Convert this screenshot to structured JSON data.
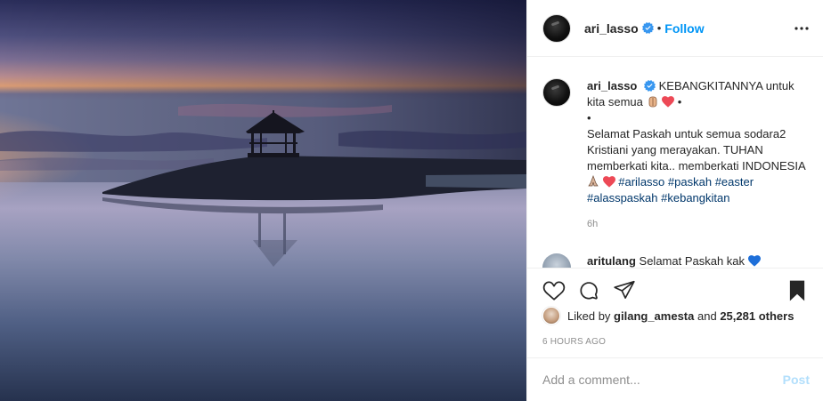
{
  "post": {
    "author": {
      "username": "ari_lasso",
      "verified": true
    },
    "header": {
      "separator": "•",
      "follow_label": "Follow",
      "more_icon": "more-horizontal-icon"
    },
    "caption": {
      "username": "ari_lasso",
      "line1": "KEBANGKITANNYA untuk kita semua",
      "bullet1": "•",
      "bullet2": "•",
      "body1": "Selamat Paskah untuk semua sodara2 Kristiani yang merayakan. TUHAN memberkati kita.. memberkati INDONESIA",
      "hashtags": [
        "#arilasso",
        "#paskah",
        "#easter",
        "#alasspaskah",
        "#kebangkitan"
      ],
      "time_ago": "6h"
    },
    "reply": {
      "username": "aritulang",
      "text": "Selamat Paskah kak"
    },
    "actions": {
      "like_icon": "heart-outline-icon",
      "comment_icon": "comment-icon",
      "share_icon": "paper-plane-icon",
      "save_icon": "bookmark-filled-icon"
    },
    "likes": {
      "prefix": "Liked by",
      "liker": "gilang_amesta",
      "and": "and",
      "others": "25,281 others"
    },
    "age": "6 HOURS AGO",
    "comment_box": {
      "placeholder": "Add a comment...",
      "post_label": "Post"
    },
    "colors": {
      "link_blue": "#0095f6",
      "hashtag": "#00376b",
      "muted": "#8e8e8e",
      "post_disabled": "#b2dffc",
      "heart_red": "#ed4956"
    }
  }
}
